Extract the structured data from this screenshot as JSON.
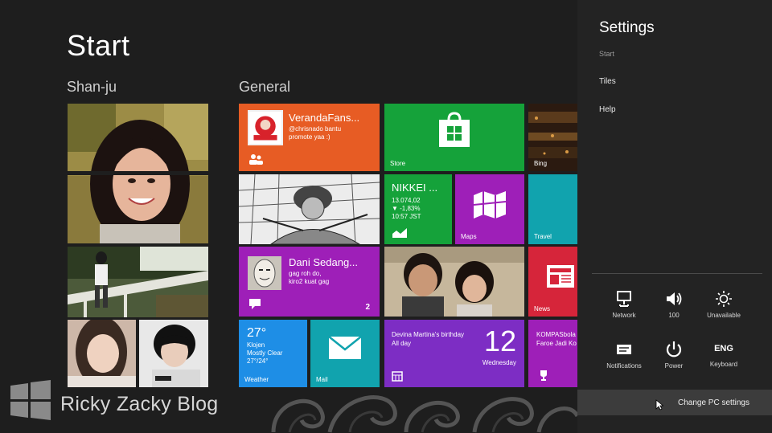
{
  "start": {
    "title": "Start",
    "groups": [
      "Shan-ju",
      "General"
    ]
  },
  "tiles": {
    "veranda": {
      "title": "VerandaFans...",
      "line1": "@chrisnado bantu",
      "line2": "promote yaa :)"
    },
    "store": {
      "label": "Store"
    },
    "bing": {
      "label": "Bing"
    },
    "finance": {
      "title": "NIKKEI ...",
      "line1": "13.074,02",
      "line2": "▼ -1,83%",
      "line3": "10:57 JST"
    },
    "maps": {
      "label": "Maps"
    },
    "travel": {
      "label": "Travel"
    },
    "people": {
      "title": "Dani Sedang...",
      "line1": "gag roh do,",
      "line2": "kiro2 kuat gag",
      "count": "2"
    },
    "news": {
      "label": "News"
    },
    "weather": {
      "temp": "27°",
      "line1": "Klojen",
      "line2": "Mostly Clear",
      "line3": "27°/24°",
      "label": "Weather"
    },
    "mail": {
      "label": "Mail"
    },
    "calendar": {
      "event": "Devina Martina's birthday",
      "when": "All day",
      "day": "12",
      "weekday": "Wednesday"
    },
    "sports": {
      "line1": "KOMPASbola",
      "line2": "Faroe Jadi Ko"
    }
  },
  "charms": {
    "title": "Settings",
    "context": "Start",
    "links": [
      "Tiles",
      "Help"
    ],
    "quick": [
      {
        "label": "Network",
        "icon": "network-icon"
      },
      {
        "label": "100",
        "icon": "volume-icon"
      },
      {
        "label": "Unavailable",
        "icon": "brightness-icon"
      },
      {
        "label": "Notifications",
        "icon": "notifications-icon"
      },
      {
        "label": "Power",
        "icon": "power-icon"
      },
      {
        "label": "Keyboard",
        "icon": "keyboard-icon",
        "glyph": "ENG"
      }
    ],
    "change_pc": "Change PC settings"
  },
  "watermark": {
    "text": "Ricky Zacky Blog"
  },
  "colors": {
    "background": "#1e1e1e",
    "charms_bg": "#232323",
    "orange": "#e75c24",
    "green": "#15a23a",
    "purple": "#9e1fb8",
    "teal": "#11a3ae",
    "red": "#d6253a",
    "blue": "#1e8ee6",
    "calendar": "#7d2dc4"
  }
}
